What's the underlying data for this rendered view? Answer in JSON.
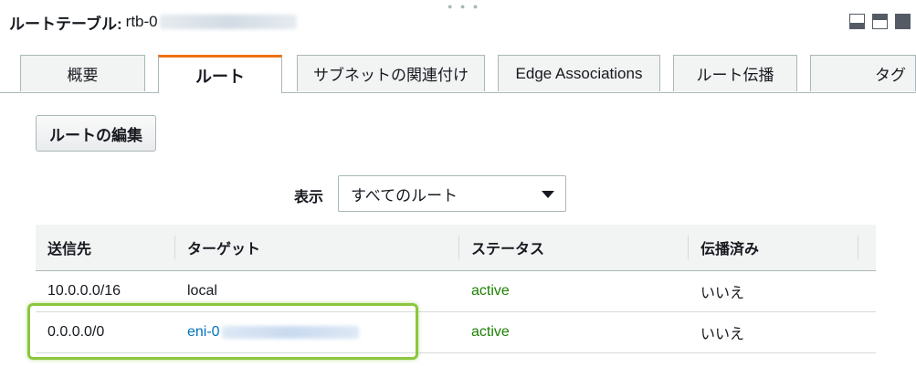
{
  "header": {
    "label": "ルートテーブル:",
    "route_table_id": "rtb-0"
  },
  "tabs": [
    {
      "label": "概要"
    },
    {
      "label": "ルート"
    },
    {
      "label": "サブネットの関連付け"
    },
    {
      "label": "Edge Associations"
    },
    {
      "label": "ルート伝播"
    },
    {
      "label": "タグ"
    }
  ],
  "active_tab": "ルート",
  "edit_button_label": "ルートの編集",
  "filter": {
    "label": "表示",
    "selected": "すべてのルート"
  },
  "table": {
    "columns": [
      "送信先",
      "ターゲット",
      "ステータス",
      "伝播済み"
    ],
    "rows": [
      {
        "destination": "10.0.0.0/16",
        "target": "local",
        "status": "active",
        "propagated": "いいえ"
      },
      {
        "destination": "0.0.0.0/0",
        "target": "eni-0",
        "status": "active",
        "propagated": "いいえ"
      }
    ]
  },
  "colors": {
    "active_tab_accent": "#ec7211",
    "status_active": "#1d8102",
    "link": "#0073bb",
    "highlight": "#8cc63f"
  }
}
